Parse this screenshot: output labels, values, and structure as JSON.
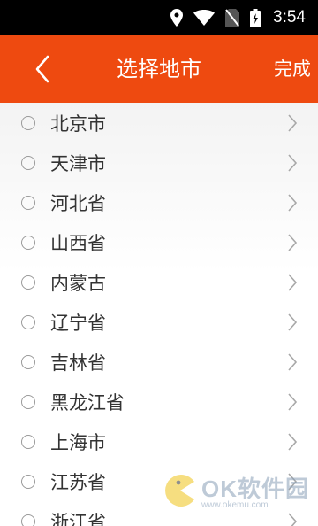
{
  "status_bar": {
    "time": "3:54",
    "icons": [
      "location-icon",
      "wifi-icon",
      "no-sim-icon",
      "battery-charging-icon"
    ]
  },
  "header": {
    "back_icon": "chevron-left-icon",
    "title": "选择地市",
    "done_label": "完成",
    "background": "#ee4a10"
  },
  "list": {
    "items": [
      {
        "label": "北京市"
      },
      {
        "label": "天津市"
      },
      {
        "label": "河北省"
      },
      {
        "label": "山西省"
      },
      {
        "label": "内蒙古"
      },
      {
        "label": "辽宁省"
      },
      {
        "label": "吉林省"
      },
      {
        "label": "黑龙江省"
      },
      {
        "label": "上海市"
      },
      {
        "label": "江苏省"
      },
      {
        "label": "浙江省"
      }
    ]
  },
  "watermark": {
    "brand": "OK软件园",
    "url": "www.okemu.com"
  }
}
